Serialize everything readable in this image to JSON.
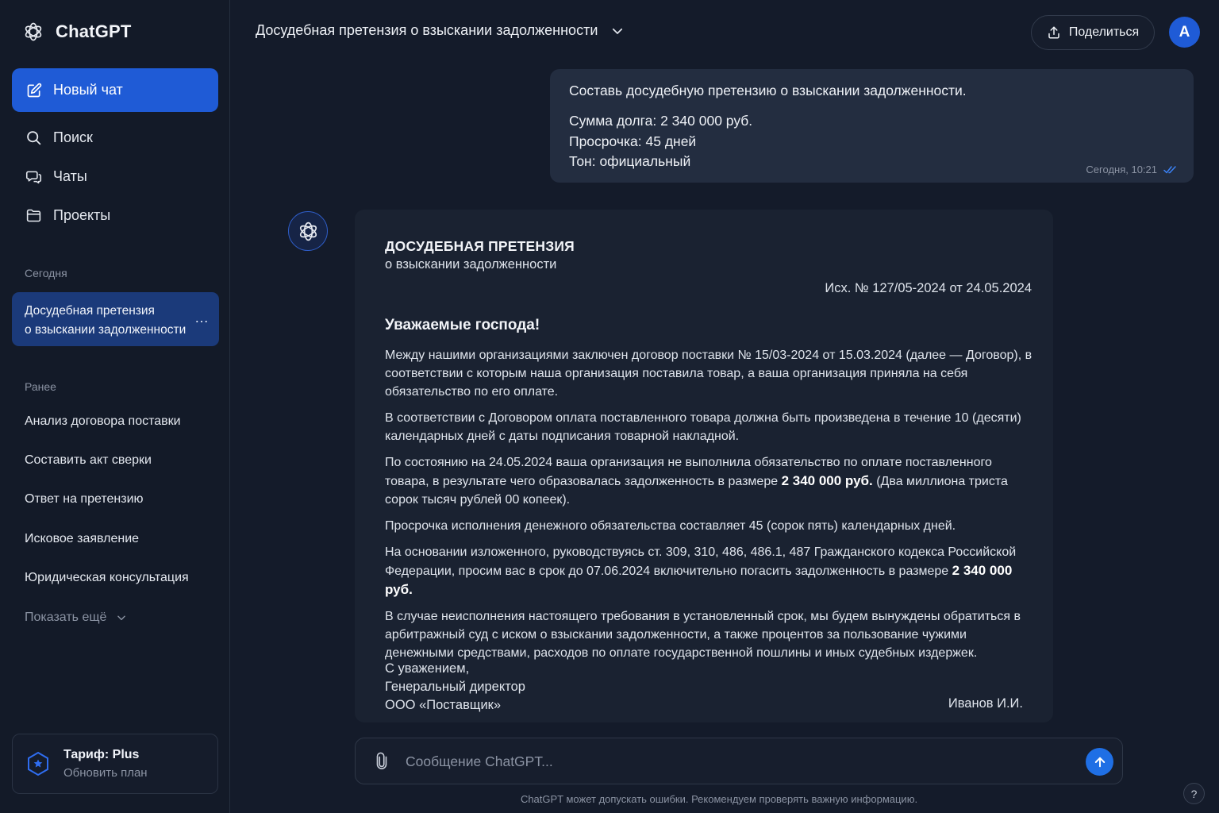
{
  "app": {
    "brand": "ChatGPT",
    "colors": {
      "accent": "#1f5bd6",
      "background": "#141b2a",
      "sidebar": "#131a28",
      "active_chat": "#1b3a7a"
    }
  },
  "sidebar": {
    "new_chat_label": "Новый чат",
    "nav": [
      {
        "label": "Поиск",
        "icon": "search-icon"
      },
      {
        "label": "Чаты",
        "icon": "chats-icon"
      },
      {
        "label": "Проекты",
        "icon": "folder-icon"
      }
    ],
    "today_label": "Сегодня",
    "active_chat": {
      "line1": "Досудебная претензия",
      "line2": "о взыскании задолженности",
      "menu": "…"
    },
    "earlier_label": "Ранее",
    "history": [
      "Анализ договора поставки",
      "Составить акт сверки",
      "Ответ на претензию",
      "Исковое заявление",
      "Юридическая консультация"
    ],
    "show_more": "Показать ещё",
    "plan": {
      "title": "Тариф: Plus",
      "subtitle": "Обновить план"
    }
  },
  "header": {
    "title": "Досудебная претензия о взыскании задолженности",
    "share": "Поделиться",
    "avatar": "A"
  },
  "user_message": {
    "line1": "Составь досудебную претензию о взыскании задолженности.",
    "lines": [
      "Сумма долга: 2 340 000 руб.",
      "Просрочка: 45 дней",
      "Тон: официальный"
    ],
    "time": "Сегодня, 10:21"
  },
  "document": {
    "title": "ДОСУДЕБНАЯ ПРЕТЕНЗИЯ",
    "subtitle": "о взыскании задолженности",
    "ref": "Исх. № 127/05-2024 от 24.05.2024",
    "greeting": "Уважаемые господа!",
    "p1": "Между нашими организациями заключен договор поставки № 15/03-2024 от 15.03.2024 (далее — Договор), в соответствии с которым наша организация поставила товар, а ваша организация приняла на себя обязательство по его оплате.",
    "p2": "В соответствии с Договором оплата поставленного товара должна быть произведена в течение 10 (десяти) календарных дней с даты подписания товарной накладной.",
    "p3_before": "По состоянию на 24.05.2024 ваша организация не выполнила обязательство по оплате поставленного товара, в результате чего образовалась задолженность в размере ",
    "p3_amount": "2 340 000 руб.",
    "p3_after": " (Два миллиона триста сорок тысяч рублей 00 копеек).",
    "p4": "Просрочка исполнения денежного обязательства составляет 45 (сорок пять) календарных дней.",
    "p5_before": "На основании изложенного, руководствуясь ст. 309, 310, 486, 486.1, 487 Гражданского кодекса Российской Федерации, просим вас в срок до 07.06.2024 включительно погасить задолженность в размере ",
    "p5_amount": "2 340 000 руб.",
    "p6": "В случае неисполнения настоящего требования в установленный срок, мы будем вынуждены обратиться в арбитражный суд с иском о взыскании задолженности, а также процентов за пользование чужими денежными средствами, расходов по оплате государственной пошлины и иных судебных издержек.",
    "sign1": "С уважением,",
    "sign2": "Генеральный директор",
    "sign3": "ООО «Поставщик»",
    "signer": "Иванов И.И."
  },
  "composer": {
    "placeholder": "Сообщение ChatGPT...",
    "disclaimer": "ChatGPT может допускать ошибки. Рекомендуем проверять важную информацию.",
    "help": "?"
  }
}
